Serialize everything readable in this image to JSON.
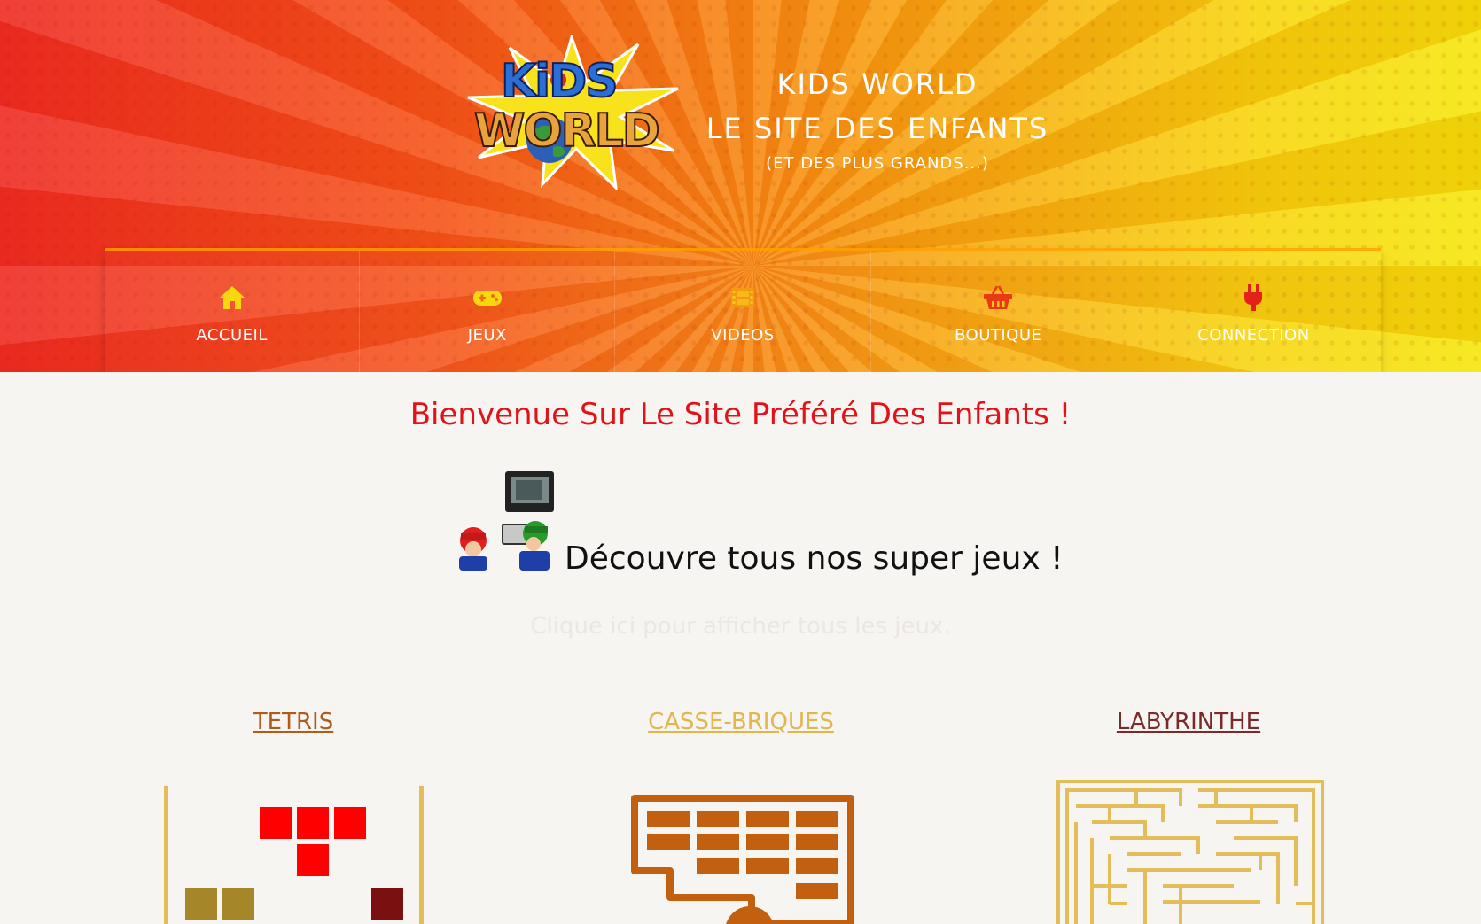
{
  "header": {
    "logo": {
      "line1": "KiDS",
      "line2": "WORLD"
    },
    "title_line1": "KIDS WORLD",
    "title_line2": "LE SITE DES ENFANTS",
    "title_line3": "(ET DES PLUS GRANDS...)"
  },
  "nav": {
    "items": [
      {
        "label": "ACCUEIL",
        "icon": "home-icon",
        "color": "#f7d80f"
      },
      {
        "label": "JEUX",
        "icon": "gamepad-icon",
        "color": "#f7d80f"
      },
      {
        "label": "VIDEOS",
        "icon": "film-icon",
        "color": "#f29a12"
      },
      {
        "label": "BOUTIQUE",
        "icon": "basket-icon",
        "color": "#ea3a14"
      },
      {
        "label": "CONNECTION",
        "icon": "plug-icon",
        "color": "#e4201a"
      }
    ]
  },
  "main": {
    "welcome": "Bienvenue Sur Le Site Préféré Des Enfants !",
    "promo_text": "Découvre tous nos super jeux !",
    "show_all": "Clique ici pour afficher tous les jeux.",
    "games": [
      {
        "title": "TETRIS",
        "color": "#b05a1b"
      },
      {
        "title": "CASSE-BRIQUES",
        "color": "#e2b64c"
      },
      {
        "title": "LABYRINTHE",
        "color": "#7a2a2a"
      }
    ]
  }
}
